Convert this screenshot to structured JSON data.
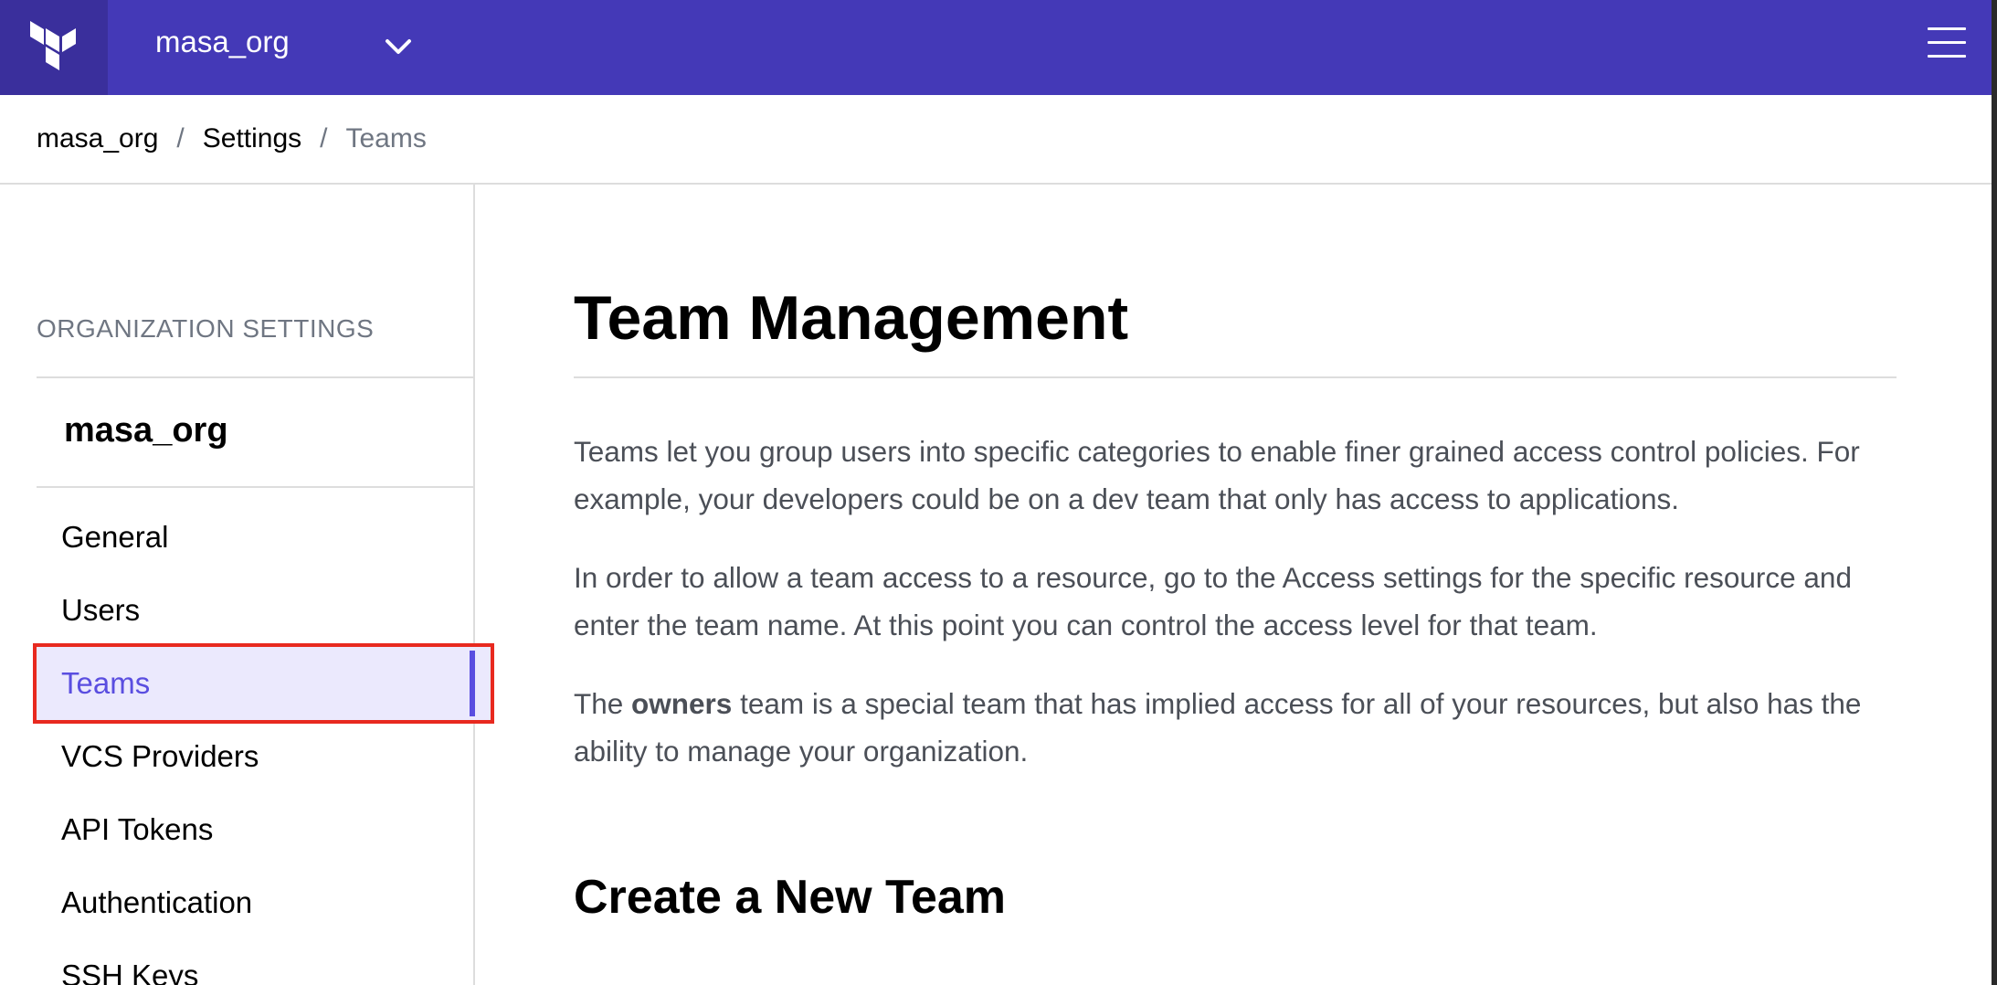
{
  "header": {
    "org_name": "masa_org",
    "logo_icon": "terraform-logo-icon",
    "menu_icon": "hamburger-menu-icon",
    "colors": {
      "nav_bg": "#4439b7",
      "logo_bg": "#3a2f9c",
      "accent": "#5a4ee0",
      "highlight_border": "#e8291f"
    }
  },
  "breadcrumb": {
    "items": [
      "masa_org",
      "Settings",
      "Teams"
    ],
    "separator": "/"
  },
  "sidebar": {
    "heading": "ORGANIZATION SETTINGS",
    "org_name": "masa_org",
    "items": [
      {
        "label": "General"
      },
      {
        "label": "Users"
      },
      {
        "label": "Teams",
        "active": true
      },
      {
        "label": "VCS Providers"
      },
      {
        "label": "API Tokens"
      },
      {
        "label": "Authentication"
      },
      {
        "label": "SSH Keys"
      }
    ]
  },
  "main": {
    "title": "Team Management",
    "paragraph1": "Teams let you group users into specific categories to enable finer grained access control policies. For example, your developers could be on a dev team that only has access to applications.",
    "paragraph2": "In order to allow a team access to a resource, go to the Access settings for the specific resource and enter the team name. At this point you can control the access level for that team.",
    "paragraph3_prefix": "The",
    "paragraph3_bold": "owners",
    "paragraph3_suffix": "team is a special team that has implied access for all of your resources, but also has the ability to manage your organization.",
    "section_title": "Create a New Team"
  }
}
